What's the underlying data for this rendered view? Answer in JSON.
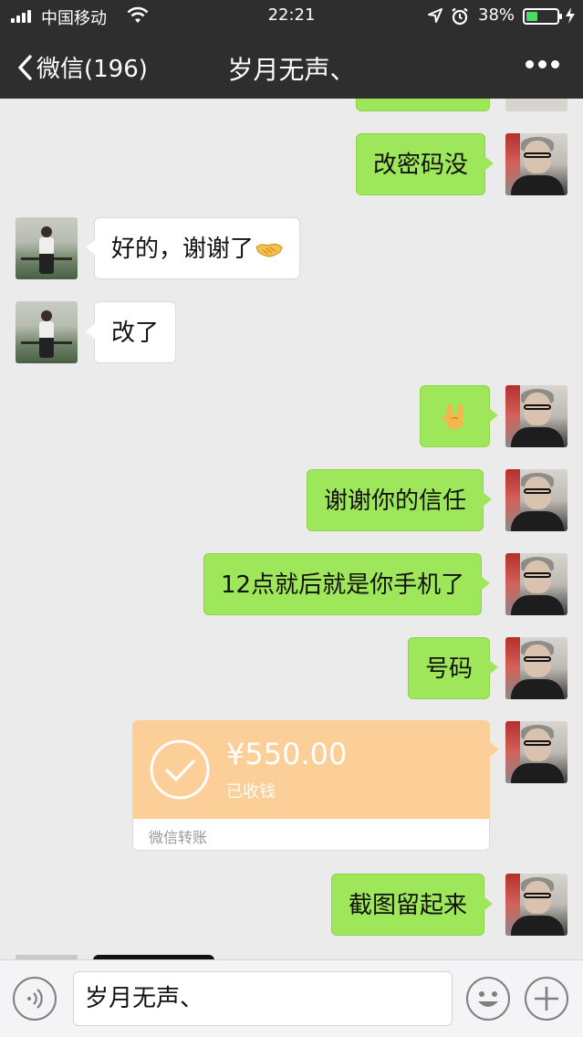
{
  "status_bar": {
    "carrier": "中国移动",
    "time": "22:21",
    "battery_percent": "38%",
    "battery_level": 0.38,
    "icons": [
      "signal-icon",
      "wifi-icon",
      "location-icon",
      "alarm-icon",
      "battery-icon",
      "charging-icon"
    ]
  },
  "nav": {
    "back_label": "微信(196)",
    "title": "岁月无声、",
    "more_icon": "more-icon"
  },
  "messages": [
    {
      "side": "out",
      "text": "改密码没"
    },
    {
      "side": "in",
      "text": "好的，谢谢了",
      "emoji": "handshake-emoji"
    },
    {
      "side": "in",
      "text": "改了"
    },
    {
      "side": "out",
      "emoji": "rock-on-hand-emoji"
    },
    {
      "side": "out",
      "text": "谢谢你的信任"
    },
    {
      "side": "out",
      "text": "12点就后就是你手机了"
    },
    {
      "side": "out",
      "text": "号码"
    },
    {
      "side": "out",
      "type": "transfer",
      "amount": "¥550.00",
      "status": "已收钱",
      "label": "微信转账"
    },
    {
      "side": "out",
      "text": "截图留起来"
    }
  ],
  "input": {
    "value": "岁月无声、",
    "icons": [
      "voice-icon",
      "emoji-icon",
      "plus-icon"
    ]
  },
  "colors": {
    "nav_bg": "#2e2e2e",
    "chat_bg": "#ebebeb",
    "outgoing_bubble": "#9fe75a",
    "incoming_bubble": "#ffffff",
    "transfer_card": "#fdcf98",
    "battery_fill": "#4cd964"
  }
}
